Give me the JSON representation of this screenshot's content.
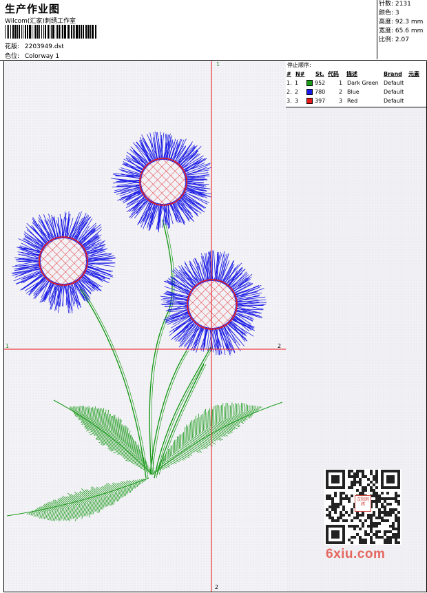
{
  "header": {
    "title": "生产作业图",
    "subtitle": "Wilcom(汇家)刺绣工作室",
    "pattern_label": "花版:",
    "pattern_value": "2203949.dst",
    "colorway_label": "色位:",
    "colorway_value": "Colorway 1"
  },
  "stats": [
    {
      "label": "针数:",
      "value": "2131"
    },
    {
      "label": "颜色:",
      "value": "3"
    },
    {
      "label": "高度:",
      "value": "92.3 mm"
    },
    {
      "label": "宽度:",
      "value": "65.6 mm"
    },
    {
      "label": "比例:",
      "value": "2.07"
    }
  ],
  "stop_sequence": {
    "title": "停止顺序:",
    "headers": {
      "hash": "#",
      "no": "N#",
      "st": "St.",
      "code": "代码",
      "desc": "描述",
      "brand": "Brand",
      "elements": "元素"
    },
    "rows": [
      {
        "index": "1.",
        "no": "1",
        "color": "#1a9a1a",
        "stitches": "952",
        "code": "1",
        "desc": "Dark Green",
        "brand": "Default"
      },
      {
        "index": "2.",
        "no": "2",
        "color": "#1a1ae6",
        "stitches": "780",
        "code": "2",
        "desc": "Blue",
        "brand": "Default"
      },
      {
        "index": "3.",
        "no": "3",
        "color": "#e61a1a",
        "stitches": "397",
        "code": "3",
        "desc": "Red",
        "brand": "Default"
      }
    ]
  },
  "axes": {
    "top": "1",
    "bottom": "2",
    "left": "1",
    "right": "2"
  },
  "watermark": {
    "badge": "汉阳刺绣",
    "site": "6xiu.com"
  },
  "colors": {
    "green": "#1a9a1a",
    "blue": "#1a1ae6",
    "red": "#e61a1a",
    "crosshair": "#e8141a"
  }
}
